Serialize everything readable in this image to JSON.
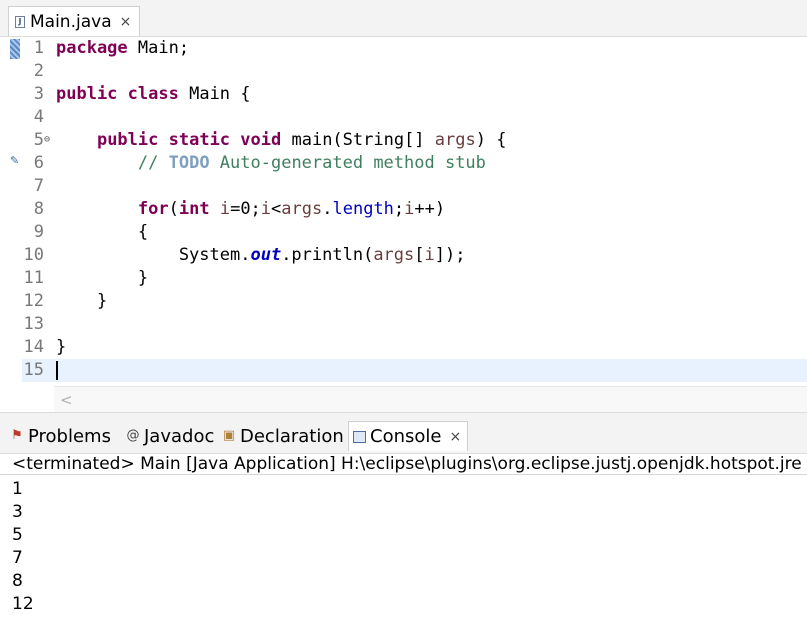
{
  "editor": {
    "tab_label": "Main.java",
    "tab_close": "×",
    "lines": [
      {
        "num": "1",
        "html_segments": [
          {
            "t": "package",
            "c": "kw"
          },
          {
            "t": " Main;"
          }
        ]
      },
      {
        "num": "2",
        "html_segments": []
      },
      {
        "num": "3",
        "html_segments": [
          {
            "t": "public",
            "c": "kw"
          },
          {
            "t": " "
          },
          {
            "t": "class",
            "c": "kw"
          },
          {
            "t": " Main {"
          }
        ]
      },
      {
        "num": "4",
        "html_segments": []
      },
      {
        "num": "5",
        "fold": "⊖",
        "html_segments": [
          {
            "t": "    "
          },
          {
            "t": "public",
            "c": "kw"
          },
          {
            "t": " "
          },
          {
            "t": "static",
            "c": "kw"
          },
          {
            "t": " "
          },
          {
            "t": "void",
            "c": "kw"
          },
          {
            "t": " main(String[] "
          },
          {
            "t": "args",
            "c": "var"
          },
          {
            "t": ") {"
          }
        ]
      },
      {
        "num": "6",
        "html_segments": [
          {
            "t": "        "
          },
          {
            "t": "// ",
            "c": "cm"
          },
          {
            "t": "TODO",
            "c": "todo"
          },
          {
            "t": " Auto-generated method stub",
            "c": "cm"
          }
        ]
      },
      {
        "num": "7",
        "html_segments": []
      },
      {
        "num": "8",
        "html_segments": [
          {
            "t": "        "
          },
          {
            "t": "for",
            "c": "kw"
          },
          {
            "t": "("
          },
          {
            "t": "int",
            "c": "kw"
          },
          {
            "t": " "
          },
          {
            "t": "i",
            "c": "var"
          },
          {
            "t": "=0;"
          },
          {
            "t": "i",
            "c": "var"
          },
          {
            "t": "<"
          },
          {
            "t": "args",
            "c": "var"
          },
          {
            "t": "."
          },
          {
            "t": "length",
            "c": "fld2"
          },
          {
            "t": ";"
          },
          {
            "t": "i",
            "c": "var"
          },
          {
            "t": "++)"
          }
        ]
      },
      {
        "num": "9",
        "html_segments": [
          {
            "t": "        {"
          }
        ]
      },
      {
        "num": "10",
        "html_segments": [
          {
            "t": "            System."
          },
          {
            "t": "out",
            "c": "fld"
          },
          {
            "t": ".println("
          },
          {
            "t": "args",
            "c": "var"
          },
          {
            "t": "["
          },
          {
            "t": "i",
            "c": "var"
          },
          {
            "t": "]);"
          }
        ]
      },
      {
        "num": "11",
        "html_segments": [
          {
            "t": "        }"
          }
        ]
      },
      {
        "num": "12",
        "html_segments": [
          {
            "t": "    }"
          }
        ]
      },
      {
        "num": "13",
        "html_segments": []
      },
      {
        "num": "14",
        "html_segments": [
          {
            "t": "}"
          }
        ]
      },
      {
        "num": "15",
        "html_segments": [],
        "current": true
      }
    ]
  },
  "panel": {
    "tabs": [
      {
        "label": "Problems",
        "icon": "problems-icon"
      },
      {
        "label": "Javadoc",
        "icon": "javadoc-icon"
      },
      {
        "label": "Declaration",
        "icon": "declaration-icon"
      },
      {
        "label": "Console",
        "icon": "console-icon",
        "active": true
      }
    ],
    "close": "×"
  },
  "console": {
    "header": "<terminated> Main [Java Application] H:\\eclipse\\plugins\\org.eclipse.justj.openjdk.hotspot.jre",
    "output": [
      "1",
      "3",
      "5",
      "7",
      "8",
      "12"
    ]
  }
}
